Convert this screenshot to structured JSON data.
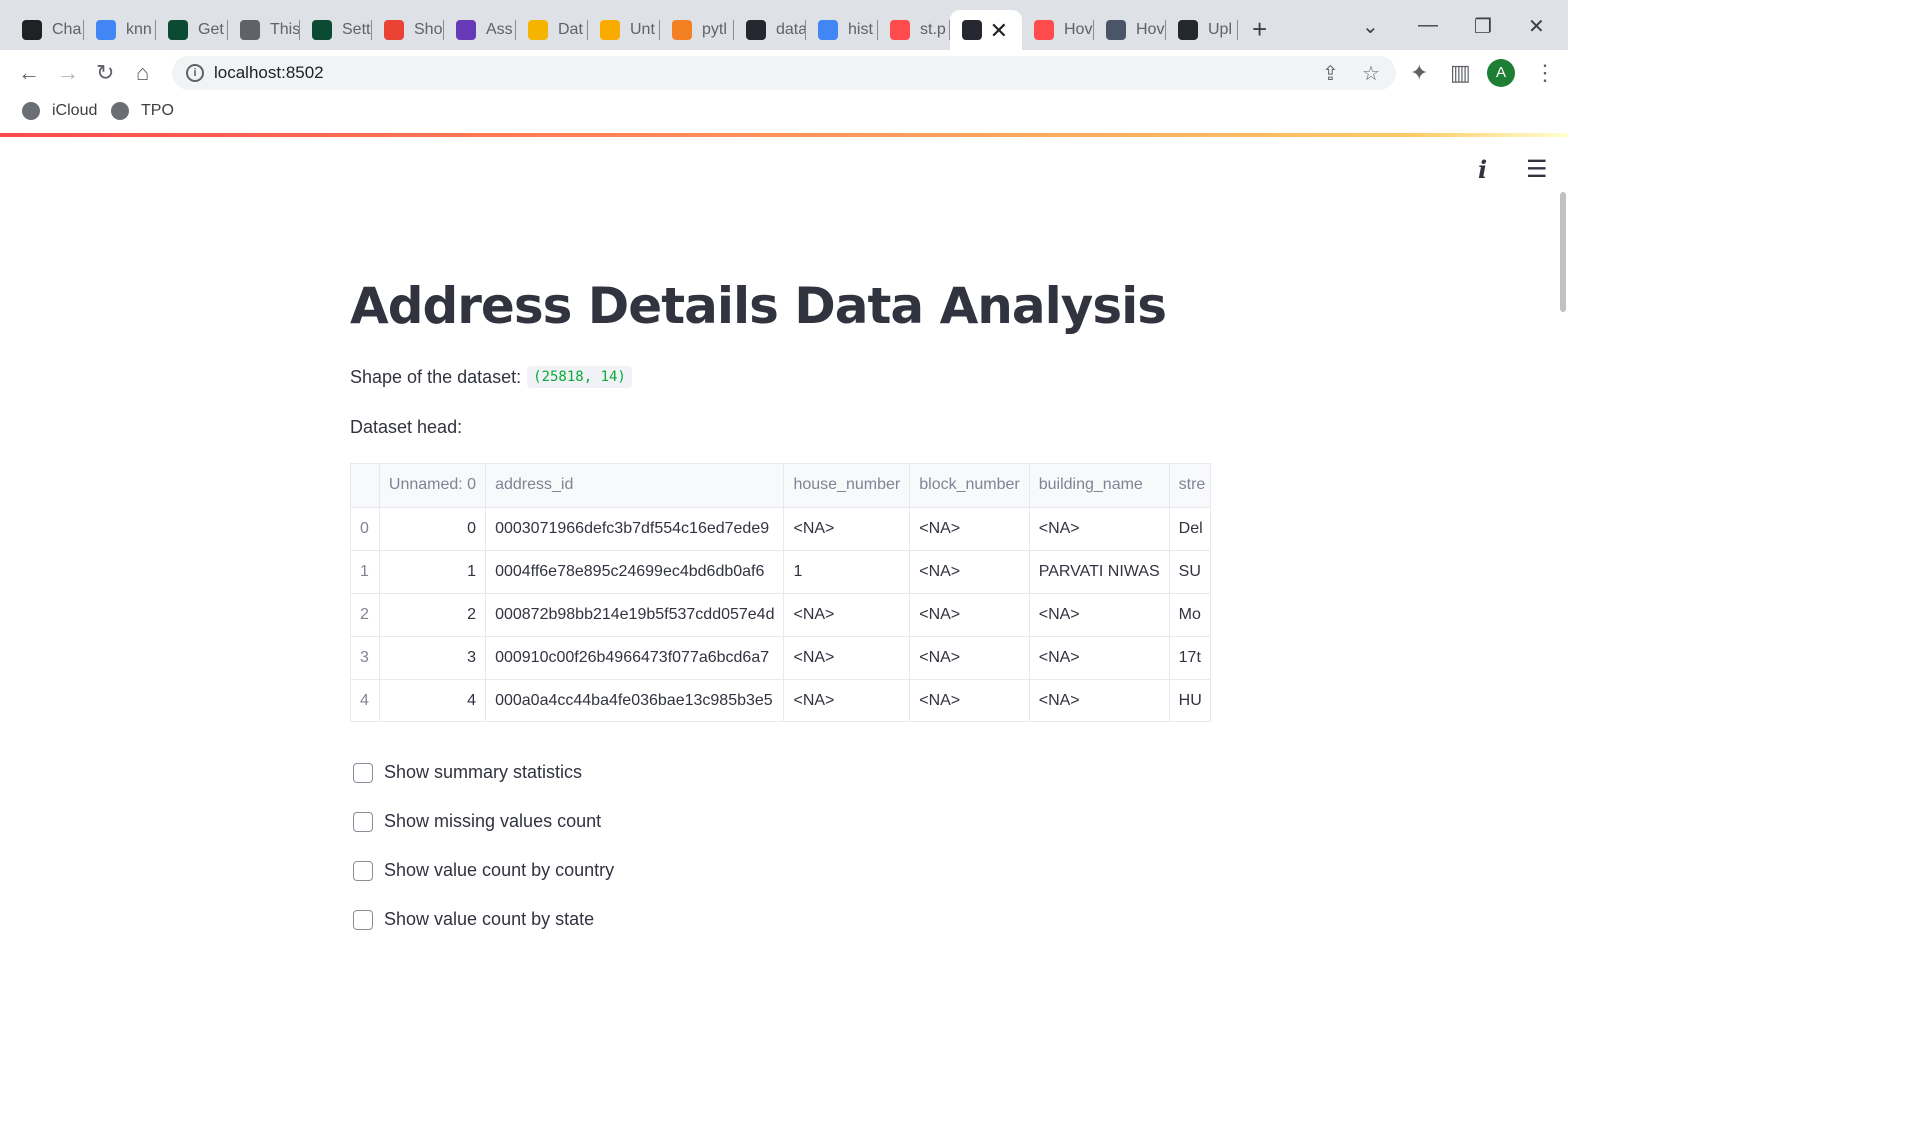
{
  "browser": {
    "tabs": [
      {
        "label": "Cha",
        "icon": "chatgpt-icon",
        "color": "#202124"
      },
      {
        "label": "knn",
        "icon": "google-icon",
        "color": "#4285f4"
      },
      {
        "label": "Get",
        "icon": "django-icon",
        "color": "#0c4b33"
      },
      {
        "label": "This",
        "icon": "globe-icon",
        "color": "#5f6368"
      },
      {
        "label": "Sett",
        "icon": "django-icon",
        "color": "#0c4b33"
      },
      {
        "label": "Sho",
        "icon": "gmail-icon",
        "color": "#ea4335"
      },
      {
        "label": "Ass",
        "icon": "forms-icon",
        "color": "#673ab7"
      },
      {
        "label": "Dat",
        "icon": "folder-icon",
        "color": "#f4b400"
      },
      {
        "label": "Unt",
        "icon": "colab-icon",
        "color": "#f9ab00"
      },
      {
        "label": "pytl",
        "icon": "stackoverflow-icon",
        "color": "#f48024"
      },
      {
        "label": "data",
        "icon": "streamlit-icon",
        "color": "#262730"
      },
      {
        "label": "hist",
        "icon": "google-icon",
        "color": "#4285f4"
      },
      {
        "label": "st.p",
        "icon": "streamlit-crown-icon",
        "color": "#ff4b4b"
      },
      {
        "label": "",
        "icon": "streamlit-icon",
        "color": "#262730"
      },
      {
        "label": "Hov",
        "icon": "streamlit-crown-icon",
        "color": "#ff4b4b"
      },
      {
        "label": "Hov",
        "icon": "profile-icon",
        "color": "#4a5568"
      },
      {
        "label": "Upl",
        "icon": "github-icon",
        "color": "#24292f"
      }
    ],
    "url": "localhost:8502",
    "avatar_letter": "A",
    "bookmarks": [
      {
        "label": "iCloud",
        "icon": "apple-icon"
      },
      {
        "label": "TPO",
        "icon": "globe-icon"
      }
    ]
  },
  "app": {
    "title": "Address Details Data Analysis",
    "shape_label": "Shape of the dataset:",
    "shape_value": "(25818, 14)",
    "head_label": "Dataset head:",
    "table": {
      "columns": [
        "",
        "Unnamed: 0",
        "address_id",
        "house_number",
        "block_number",
        "building_name",
        "stre"
      ],
      "rows": [
        [
          "0",
          "0",
          "0003071966defc3b7df554c16ed7ede9",
          "<NA>",
          "<NA>",
          "<NA>",
          "Del"
        ],
        [
          "1",
          "1",
          "0004ff6e78e895c24699ec4bd6db0af6",
          "1",
          "<NA>",
          "PARVATI NIWAS",
          "SU"
        ],
        [
          "2",
          "2",
          "000872b98bb214e19b5f537cdd057e4d",
          "<NA>",
          "<NA>",
          "<NA>",
          "Mo"
        ],
        [
          "3",
          "3",
          "000910c00f26b4966473f077a6bcd6a7",
          "<NA>",
          "<NA>",
          "<NA>",
          "17t"
        ],
        [
          "4",
          "4",
          "000a0a4cc44ba4fe036bae13c985b3e5",
          "<NA>",
          "<NA>",
          "<NA>",
          "HU"
        ]
      ]
    },
    "checkboxes": [
      {
        "label": "Show summary statistics",
        "checked": false
      },
      {
        "label": "Show missing values count",
        "checked": false
      },
      {
        "label": "Show value count by country",
        "checked": false
      },
      {
        "label": "Show value count by state",
        "checked": false
      }
    ]
  }
}
